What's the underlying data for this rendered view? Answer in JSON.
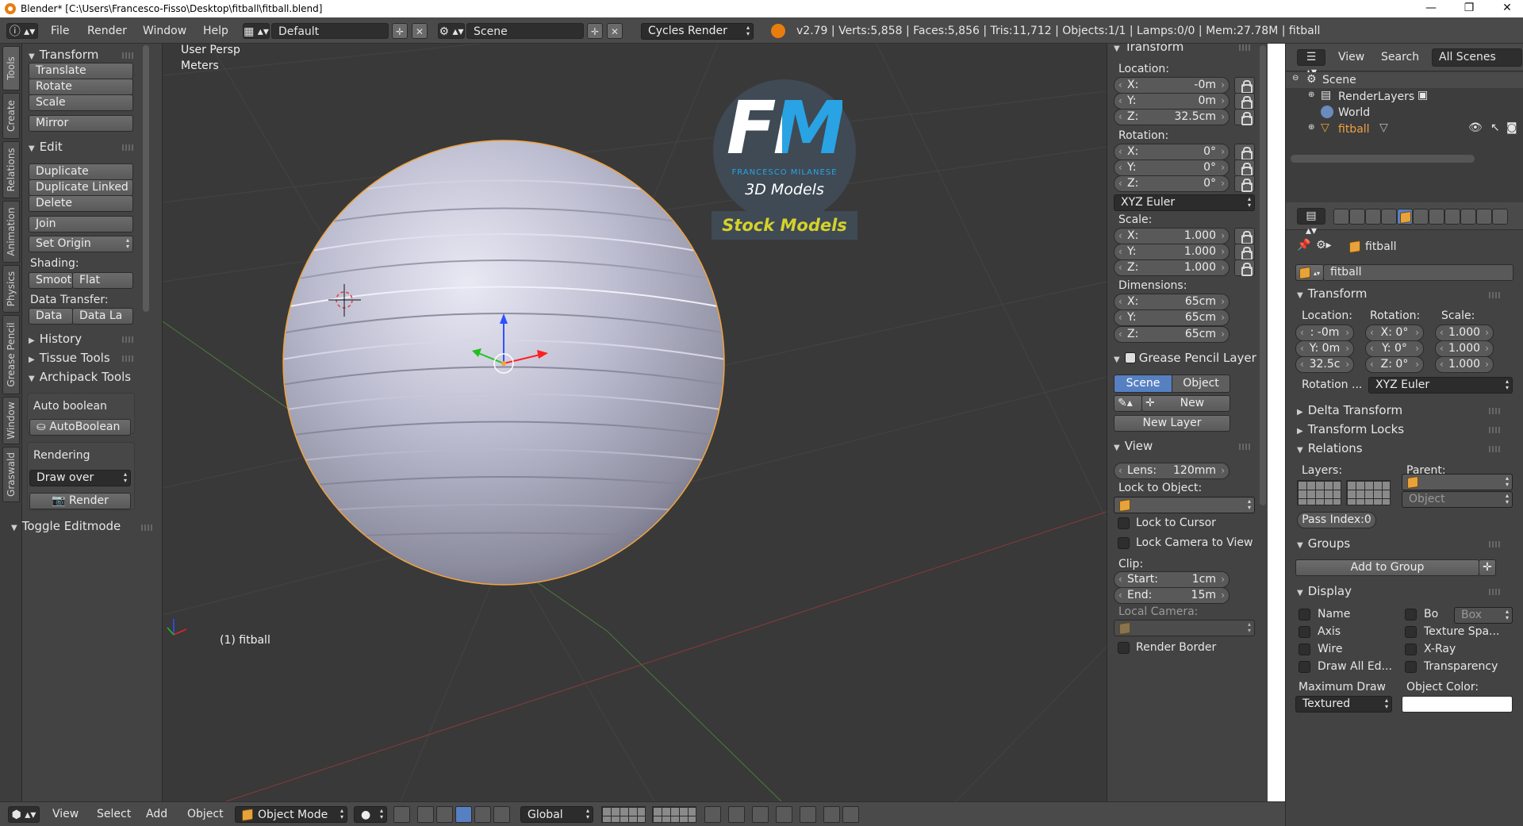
{
  "window": {
    "title": "Blender* [C:\\Users\\Francesco-Fisso\\Desktop\\fitball\\fitball.blend]",
    "controls": [
      "—",
      "❐",
      "✕"
    ]
  },
  "info_header": {
    "menus": [
      "File",
      "Render",
      "Window",
      "Help"
    ],
    "screen_layout": "Default",
    "scene": "Scene",
    "render_engine": "Cycles Render",
    "stats": "v2.79 | Verts:5,858 | Faces:5,856 | Tris:11,712 | Objects:1/1 | Lamps:0/0 | Mem:27.78M | fitball"
  },
  "shelf_tabs": [
    "Tools",
    "Create",
    "Relations",
    "Animation",
    "Physics",
    "Grease Pencil",
    "Window",
    "Graswald"
  ],
  "tool_shelf": {
    "transform": {
      "title": "Transform",
      "buttons": [
        "Translate",
        "Rotate",
        "Scale",
        "Mirror"
      ]
    },
    "edit": {
      "title": "Edit",
      "buttons": [
        "Duplicate",
        "Duplicate Linked",
        "Delete",
        "Join"
      ],
      "set_origin": "Set Origin",
      "shading_label": "Shading:",
      "shading": [
        "Smooth",
        "Flat"
      ],
      "data_transfer_label": "Data Transfer:",
      "data_transfer": [
        "Data",
        "Data La"
      ]
    },
    "history": "History",
    "tissue_tools": "Tissue Tools",
    "archipack": {
      "title": "Archipack Tools",
      "auto_boolean_label": "Auto boolean",
      "auto_boolean_button": "AutoBoolean",
      "rendering_label": "Rendering",
      "draw_mode": "Draw over",
      "render_button": "Render"
    },
    "toggle_editmode": "Toggle Editmode"
  },
  "viewport": {
    "view_name": "User Persp",
    "units": "Meters",
    "object_label": "(1) fitball",
    "watermark": {
      "initials": "FM",
      "name": "FRANCESCO MILANESE",
      "subtitle": "3D Models",
      "banner": "Stock Models"
    }
  },
  "n_panel": {
    "transform_title": "Transform",
    "location_label": "Location:",
    "location": [
      {
        "k": "X:",
        "v": "-0m"
      },
      {
        "k": "Y:",
        "v": "0m"
      },
      {
        "k": "Z:",
        "v": "32.5cm"
      }
    ],
    "rotation_label": "Rotation:",
    "rotation": [
      {
        "k": "X:",
        "v": "0°"
      },
      {
        "k": "Y:",
        "v": "0°"
      },
      {
        "k": "Z:",
        "v": "0°"
      }
    ],
    "rotation_mode": "XYZ Euler",
    "scale_label": "Scale:",
    "scale": [
      {
        "k": "X:",
        "v": "1.000"
      },
      {
        "k": "Y:",
        "v": "1.000"
      },
      {
        "k": "Z:",
        "v": "1.000"
      }
    ],
    "dimensions_label": "Dimensions:",
    "dimensions": [
      {
        "k": "X:",
        "v": "65cm"
      },
      {
        "k": "Y:",
        "v": "65cm"
      },
      {
        "k": "Z:",
        "v": "65cm"
      }
    ],
    "grease_pencil": {
      "title": "Grease Pencil Layer",
      "scene_tab": "Scene",
      "object_tab": "Object",
      "new_button": "New",
      "new_layer_button": "New Layer"
    },
    "view": {
      "title": "View",
      "lens_key": "Lens:",
      "lens_val": "120mm",
      "lock_to_object": "Lock to Object:",
      "lock_to_cursor": "Lock to Cursor",
      "lock_camera": "Lock Camera to View",
      "clip_label": "Clip:",
      "clip_start_key": "Start:",
      "clip_start_val": "1cm",
      "clip_end_key": "End:",
      "clip_end_val": "15m",
      "local_camera": "Local Camera:",
      "render_border": "Render Border"
    }
  },
  "outliner": {
    "menus": [
      "View",
      "Search"
    ],
    "filter": "All Scenes",
    "items": [
      "Scene",
      "RenderLayers",
      "World",
      "fitball"
    ]
  },
  "properties": {
    "breadcrumb_object": "fitball",
    "object_name": "fitball",
    "transform_title": "Transform",
    "location_label": "Location:",
    "rotation_label": "Rotation:",
    "scale_label": "Scale:",
    "location": [
      ": -0m",
      "Y: 0m",
      "32.5c"
    ],
    "rotation": [
      "X: 0°",
      "Y: 0°",
      "Z: 0°"
    ],
    "scale": [
      "1.000",
      "1.000",
      "1.000"
    ],
    "rotation_mode_label": "Rotation ...",
    "rotation_mode": "XYZ Euler",
    "delta_transform": "Delta Transform",
    "transform_locks": "Transform Locks",
    "relations": {
      "title": "Relations",
      "layers_label": "Layers:",
      "parent_label": "Parent:",
      "parent_type": "Object",
      "pass_index": "Pass Index:0"
    },
    "groups": {
      "title": "Groups",
      "add_button": "Add to Group"
    },
    "display": {
      "title": "Display",
      "left": [
        "Name",
        "Axis",
        "Wire",
        "Draw All Ed..."
      ],
      "right": [
        "Bo",
        "Texture Spa...",
        "X-Ray",
        "Transparency"
      ],
      "bounds_type": "Box",
      "maximum_draw_label": "Maximum Draw",
      "maximum_draw": "Textured",
      "object_color_label": "Object Color:"
    }
  },
  "bottom_header": {
    "menus": [
      "View",
      "Select",
      "Add",
      "Object"
    ],
    "mode": "Object Mode",
    "orientation": "Global"
  },
  "colors": {
    "accent_blue": "#5680c2",
    "selection_orange": "#f1a33c",
    "ball_base": "#b9b9cc"
  }
}
